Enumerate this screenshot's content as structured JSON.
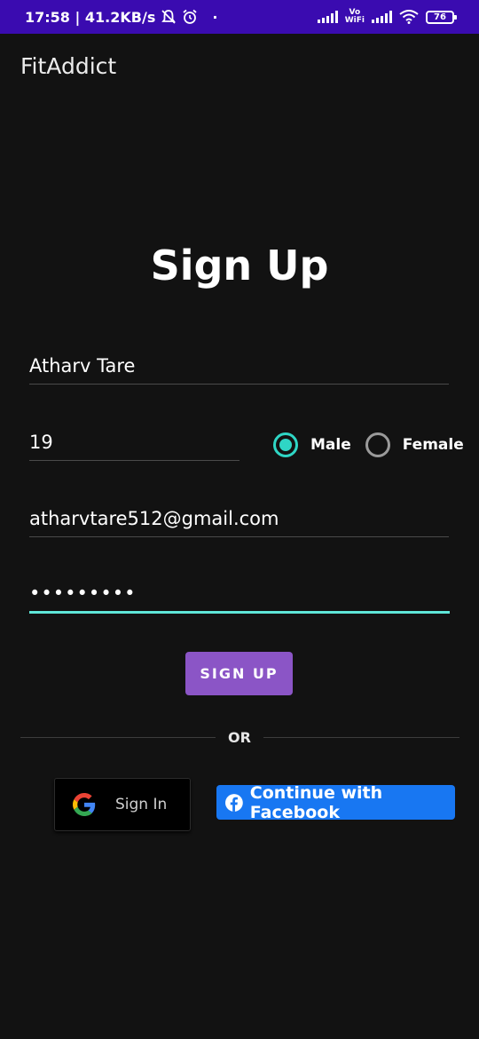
{
  "status_bar": {
    "time_speed": "17:58 | 41.2KB/s",
    "dot": "·",
    "vo": "Vo",
    "wifi": "WiFi",
    "battery": "76",
    "icons": [
      "mute-bell-icon",
      "alarm-icon",
      "signal-icon",
      "wifi-icon",
      "battery-icon"
    ]
  },
  "app_bar": {
    "title": "FitAddict"
  },
  "form": {
    "heading": "Sign Up",
    "name_value": "Atharv Tare",
    "age_value": "19",
    "gender_options": [
      {
        "label": "Male",
        "selected": true
      },
      {
        "label": "Female",
        "selected": false
      }
    ],
    "email_value": "atharvtare512@gmail.com",
    "password_value": "•••••••••",
    "submit_label": "SIGN UP"
  },
  "divider": {
    "label": "OR"
  },
  "social": {
    "google_label": "Sign In",
    "facebook_label": "Continue with Facebook"
  },
  "colors": {
    "status_bar": "#3a0bb0",
    "background": "#121212",
    "accent_teal": "#2fd6c5",
    "signup_button": "#8b55c6",
    "facebook_blue": "#1877f2"
  }
}
